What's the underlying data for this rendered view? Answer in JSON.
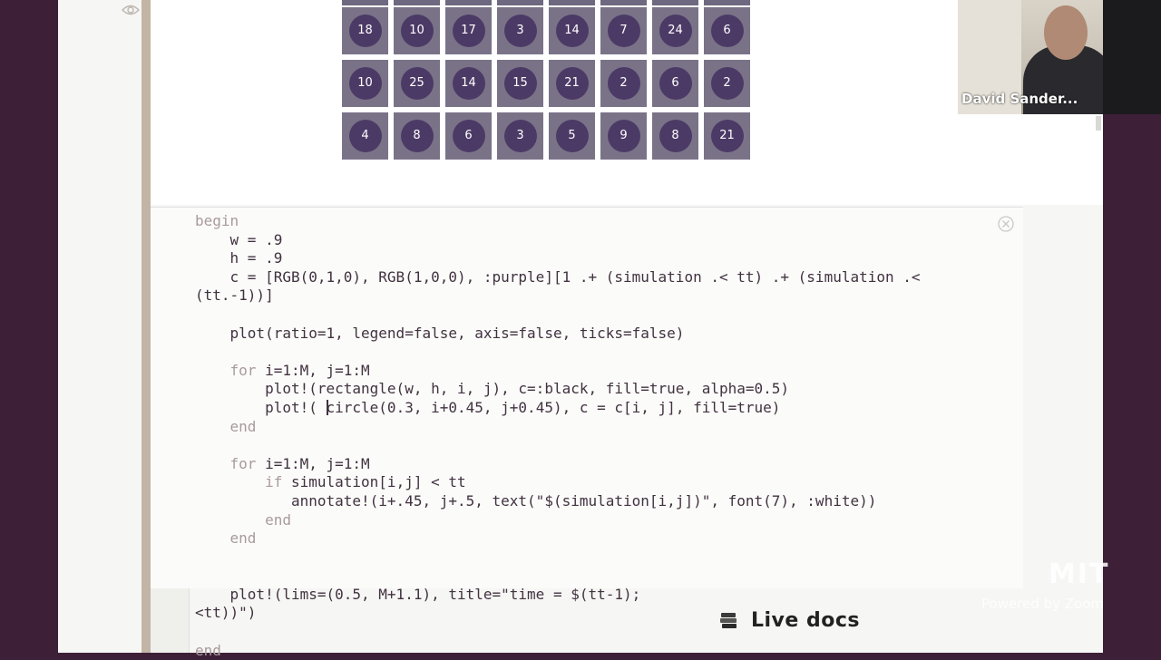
{
  "app": {
    "accent": "#3d1f38",
    "page_bg": "#f6f6f4"
  },
  "grid": {
    "cell_color": "#7a7388",
    "circle_color": "#4c3a66",
    "rows": [
      [
        "18",
        "10",
        "17",
        "3",
        "14",
        "7",
        "24",
        "6"
      ],
      [
        "10",
        "25",
        "14",
        "15",
        "21",
        "2",
        "6",
        "2"
      ],
      [
        "4",
        "8",
        "6",
        "3",
        "5",
        "9",
        "8",
        "21"
      ]
    ]
  },
  "cell": {
    "close_icon": "close-icon",
    "code": [
      {
        "parts": [
          [
            "kw",
            "begin"
          ]
        ]
      },
      {
        "parts": [
          [
            "fn",
            "    w = .9"
          ]
        ]
      },
      {
        "parts": [
          [
            "fn",
            "    h = .9"
          ]
        ]
      },
      {
        "parts": [
          [
            "fn",
            "    c = [RGB(0,1,0), RGB(1,0,0), :purple][1 .+ (simulation .< tt) .+ (simulation .<"
          ]
        ]
      },
      {
        "parts": [
          [
            "fn",
            "(tt.-1))]"
          ]
        ]
      },
      {
        "parts": [
          [
            "fn",
            ""
          ]
        ]
      },
      {
        "parts": [
          [
            "fn",
            "    plot(ratio=1, legend=false, axis=false, ticks=false)"
          ]
        ]
      },
      {
        "parts": [
          [
            "fn",
            ""
          ]
        ]
      },
      {
        "parts": [
          [
            "kw",
            "    for "
          ],
          [
            "fn",
            "i=1:M, j=1:M"
          ]
        ]
      },
      {
        "parts": [
          [
            "fn",
            "        plot!(rectangle(w, h, i, j), c=:black, fill=true, alpha=0.5)"
          ]
        ]
      },
      {
        "parts": [
          [
            "fn",
            "        plot!( "
          ],
          [
            "cursor",
            ""
          ],
          [
            "fn",
            "circle(0.3, i+0.45, j+0.45), c = c[i, j], fill=true)"
          ]
        ]
      },
      {
        "parts": [
          [
            "kw",
            "    end"
          ]
        ]
      },
      {
        "parts": [
          [
            "fn",
            ""
          ]
        ]
      },
      {
        "parts": [
          [
            "kw",
            "    for "
          ],
          [
            "fn",
            "i=1:M, j=1:M"
          ]
        ]
      },
      {
        "parts": [
          [
            "kw",
            "        if "
          ],
          [
            "fn",
            "simulation[i,j] < tt"
          ]
        ]
      },
      {
        "parts": [
          [
            "fn",
            "           annotate!(i+.45, j+.5, text(\"$(simulation[i,j])\", font(7), :white))"
          ]
        ]
      },
      {
        "parts": [
          [
            "kw",
            "        end"
          ]
        ]
      },
      {
        "parts": [
          [
            "kw",
            "    end"
          ]
        ]
      },
      {
        "parts": [
          [
            "fn",
            ""
          ]
        ]
      },
      {
        "parts": [
          [
            "fn",
            ""
          ]
        ]
      },
      {
        "parts": [
          [
            "fn",
            "    plot!(lims=(0.5, M+1.1), title=\"time = $(tt-1);"
          ]
        ]
      },
      {
        "parts": [
          [
            "fn",
            "<tt))\")"
          ]
        ]
      },
      {
        "parts": [
          [
            "fn",
            ""
          ]
        ]
      },
      {
        "parts": [
          [
            "kw",
            "end"
          ]
        ]
      }
    ]
  },
  "live_docs": {
    "label": "Live docs",
    "icon": "live-docs-icon"
  },
  "webcam": {
    "name": "David Sander..."
  },
  "watermark": {
    "logo": "MIT",
    "text": "Powered by Zoom"
  }
}
